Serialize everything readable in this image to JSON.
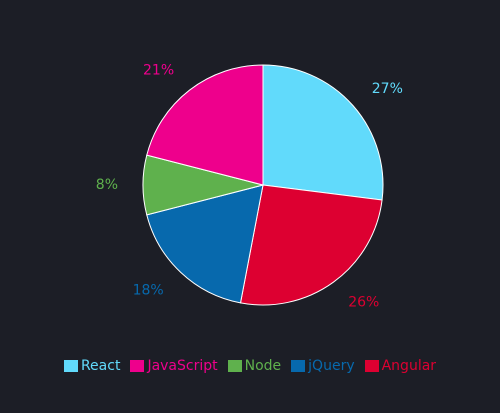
{
  "chart_data": {
    "type": "pie",
    "legend_position": "bottom-center",
    "slices": [
      {
        "label": "React",
        "value": 27,
        "display": "27%",
        "color": "#61dafb"
      },
      {
        "label": "Angular",
        "value": 26,
        "display": "26%",
        "color": "#dd0031"
      },
      {
        "label": "jQuery",
        "value": 18,
        "display": "18%",
        "color": "#0769ad"
      },
      {
        "label": "Node",
        "value": 8,
        "display": "8%",
        "color": "#5fb14d"
      },
      {
        "label": "JavaScript",
        "value": 21,
        "display": "21%",
        "color": "#ee008c"
      }
    ],
    "legend": [
      {
        "label": "React",
        "color": "#61dafb"
      },
      {
        "label": "JavaScript",
        "color": "#ee008c"
      },
      {
        "label": "Node",
        "color": "#5fb14d"
      },
      {
        "label": "jQuery",
        "color": "#0769ad"
      },
      {
        "label": "Angular",
        "color": "#dd0031"
      }
    ]
  },
  "colors": {
    "background": "#1c1e26",
    "slice_border": "#ffffff"
  }
}
